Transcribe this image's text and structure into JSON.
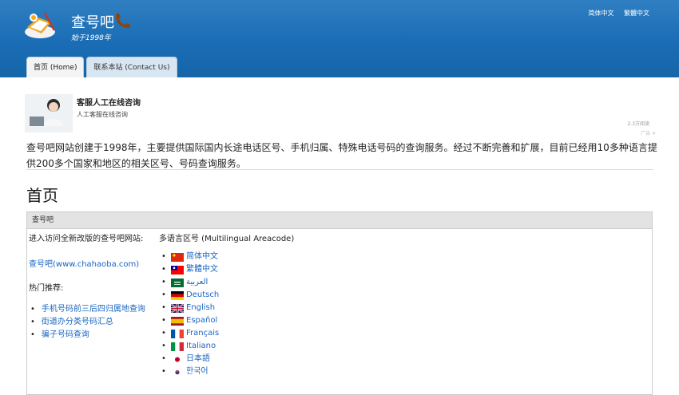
{
  "header": {
    "site_title": "查号吧",
    "slogan": "始于1998年",
    "lang_links": [
      "简体中文",
      "繁體中文"
    ]
  },
  "tabs": [
    {
      "label": "首页 (Home)"
    },
    {
      "label": "联系本站 (Contact Us)"
    }
  ],
  "ad": {
    "title": "客服人工在线咨询",
    "subtitle": "人工客服在线咨询",
    "reads": "2.3万阅读",
    "mark": "广告 ✕"
  },
  "intro": "查号吧网站创建于1998年，主要提供国际国内长途电话区号、手机归属、特殊电话号码的查询服务。经过不断完善和扩展，目前已经用10多种语言提供200多个国家和地区的相关区号、号码查询服务。",
  "page_heading": "首页",
  "panel": {
    "title": "查号吧",
    "enter_text": "进入访问全新改版的查号吧网站:",
    "multilingual": "多语言区号 (Multilingual Areacode)",
    "site_link": "查号吧(www.chahaoba.com)",
    "hot_label": "热门推荐:",
    "hot_items": [
      "手机号码前三后四归属地查询",
      "街道办分类号码汇总",
      "骗子号码查询"
    ],
    "languages": [
      {
        "name": "简体中文",
        "flag": "cn"
      },
      {
        "name": "繁體中文",
        "flag": "tw"
      },
      {
        "name": "العربية",
        "flag": "sa"
      },
      {
        "name": "Deutsch",
        "flag": "de"
      },
      {
        "name": "English",
        "flag": "gb"
      },
      {
        "name": "Español",
        "flag": "es"
      },
      {
        "name": "Français",
        "flag": "fr"
      },
      {
        "name": "Italiano",
        "flag": "it"
      },
      {
        "name": "日本語",
        "flag": "jp"
      },
      {
        "name": "한국어",
        "flag": "kr"
      }
    ]
  }
}
